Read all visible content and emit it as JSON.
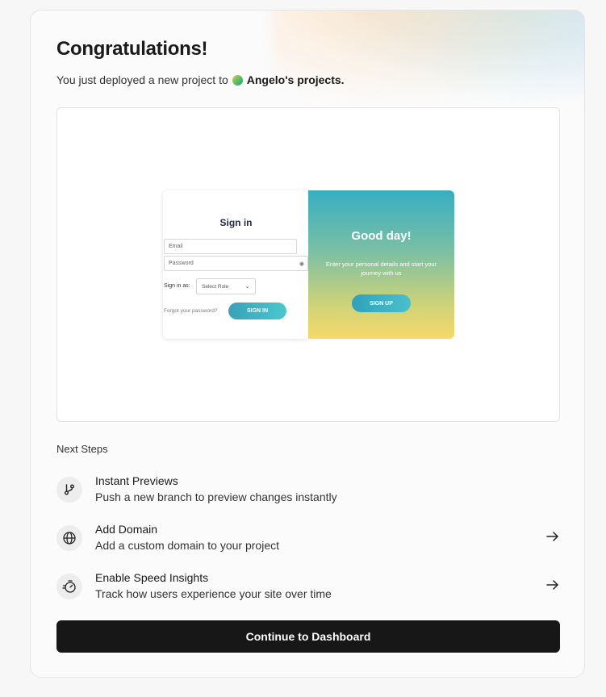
{
  "header": {
    "title": "Congratulations!",
    "subtitle_prefix": "You just deployed a new project to",
    "team_name": "Angelo's projects."
  },
  "preview": {
    "signin_title": "Sign in",
    "email_placeholder": "Email",
    "password_placeholder": "Password",
    "role_label": "Sign in as:",
    "role_select": "Select Role",
    "forgot_password": "Forgot your password?",
    "signin_button": "SIGN IN",
    "welcome_title": "Good day!",
    "welcome_desc": "Enter your personal details and start your journey with us",
    "signup_button": "SIGN UP"
  },
  "next_steps": {
    "title": "Next Steps",
    "items": [
      {
        "title": "Instant Previews",
        "desc": "Push a new branch to preview changes instantly",
        "icon": "git-branch-icon"
      },
      {
        "title": "Add Domain",
        "desc": "Add a custom domain to your project",
        "icon": "globe-icon"
      },
      {
        "title": "Enable Speed Insights",
        "desc": "Track how users experience your site over time",
        "icon": "speed-insights-icon"
      }
    ]
  },
  "cta": {
    "label": "Continue to Dashboard"
  }
}
